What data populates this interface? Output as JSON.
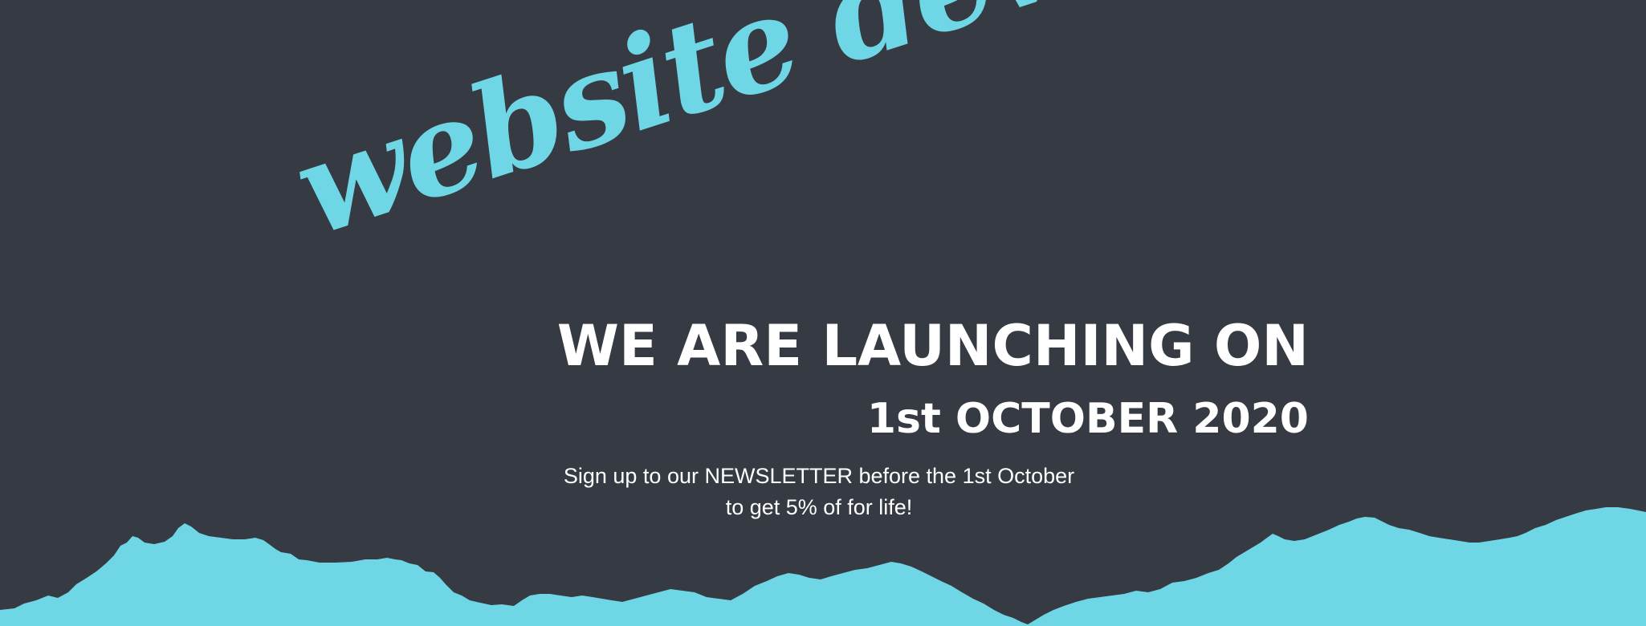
{
  "banner": {
    "script_title": "website development",
    "headline": "WE ARE LAUNCHING ON",
    "date": "1st OCTOBER 2020",
    "newsletter_line1": "Sign up to our NEWSLETTER before the 1st October",
    "newsletter_line2": "to get 5% of for life!"
  },
  "colors": {
    "background": "#353a43",
    "accent": "#6fd6e5",
    "text": "#ffffff"
  }
}
